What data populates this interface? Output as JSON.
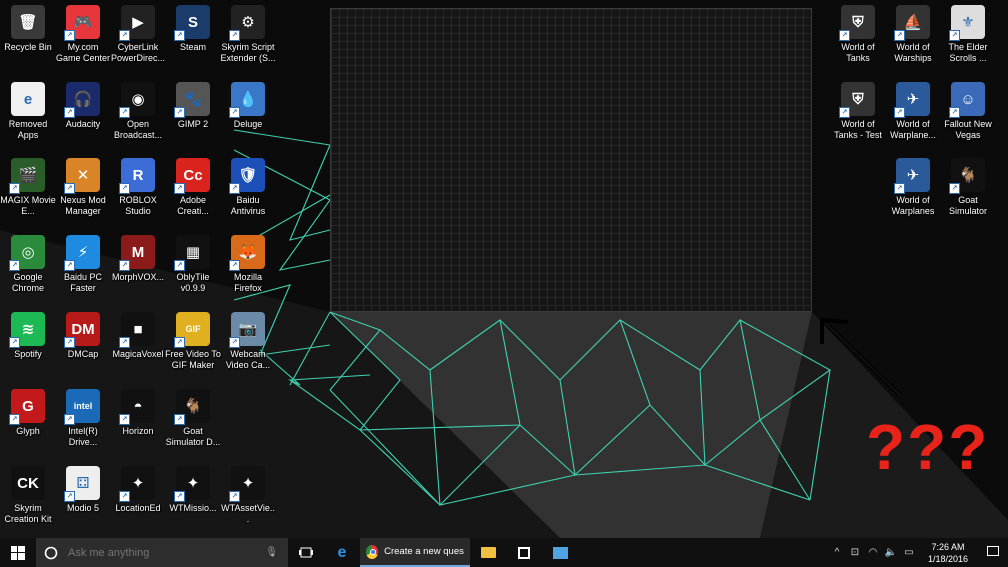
{
  "desktop": {
    "icons": [
      {
        "label": "Recycle Bin",
        "icon": "recycle-bin-icon",
        "color": "#3a3a3a",
        "glyph": "🗑",
        "shortcut": false
      },
      {
        "label": "My.com Game Center",
        "icon": "gamepad-icon",
        "color": "#e8373c",
        "glyph": "🎮",
        "shortcut": true
      },
      {
        "label": "CyberLink PowerDirec...",
        "icon": "video-editor-icon",
        "color": "#222",
        "glyph": "▶",
        "shortcut": true
      },
      {
        "label": "Steam",
        "icon": "steam-icon",
        "color": "#1b3b6b",
        "glyph": "S",
        "shortcut": true
      },
      {
        "label": "Skyrim Script Extender (S...",
        "icon": "gear-icon",
        "color": "#222",
        "glyph": "⚙",
        "shortcut": true
      },
      {
        "label": "Removed Apps",
        "icon": "document-ie-icon",
        "color": "#f0f0f0",
        "glyph": "e",
        "shortcut": false
      },
      {
        "label": "Audacity",
        "icon": "headphones-icon",
        "color": "#1a2a6a",
        "glyph": "🎧",
        "shortcut": true
      },
      {
        "label": "Open Broadcast...",
        "icon": "obs-icon",
        "color": "#111",
        "glyph": "◉",
        "shortcut": true
      },
      {
        "label": "GIMP 2",
        "icon": "gimp-icon",
        "color": "#555",
        "glyph": "🐾",
        "shortcut": true
      },
      {
        "label": "Deluge",
        "icon": "water-drop-icon",
        "color": "#3b77c8",
        "glyph": "💧",
        "shortcut": true
      },
      {
        "label": "MAGIX Movie E...",
        "icon": "film-icon",
        "color": "#2b5d2b",
        "glyph": "🎬",
        "shortcut": true
      },
      {
        "label": "Nexus Mod Manager",
        "icon": "nexus-icon",
        "color": "#d98426",
        "glyph": "✕",
        "shortcut": true
      },
      {
        "label": "ROBLOX Studio",
        "icon": "roblox-icon",
        "color": "#3c6dd6",
        "glyph": "R",
        "shortcut": true
      },
      {
        "label": "Adobe Creati...",
        "icon": "adobe-cc-icon",
        "color": "#d9231c",
        "glyph": "Cc",
        "shortcut": true
      },
      {
        "label": "Baidu Antivirus",
        "icon": "shield-icon",
        "color": "#1c4fb8",
        "glyph": "🛡",
        "shortcut": true
      },
      {
        "label": "Google Chrome",
        "icon": "chrome-icon",
        "color": "#2a8b3c",
        "glyph": "◎",
        "shortcut": true
      },
      {
        "label": "Baidu PC Faster",
        "icon": "speed-icon",
        "color": "#1f8be0",
        "glyph": "⚡",
        "shortcut": true
      },
      {
        "label": "MorphVOX...",
        "icon": "morphvox-icon",
        "color": "#8b1a1a",
        "glyph": "M",
        "shortcut": true
      },
      {
        "label": "OblyTile v0.9.9",
        "icon": "tiles-icon",
        "color": "#111",
        "glyph": "▦",
        "shortcut": true
      },
      {
        "label": "Mozilla Firefox",
        "icon": "firefox-icon",
        "color": "#d86a1a",
        "glyph": "🦊",
        "shortcut": true
      },
      {
        "label": "Spotify",
        "icon": "spotify-icon",
        "color": "#1db954",
        "glyph": "≋",
        "shortcut": true
      },
      {
        "label": "DMCap",
        "icon": "dmcap-icon",
        "color": "#b81a1a",
        "glyph": "DM",
        "shortcut": true
      },
      {
        "label": "MagicaVoxel",
        "icon": "voxel-icon",
        "color": "#111",
        "glyph": "■",
        "shortcut": true
      },
      {
        "label": "Free Video To GIF Maker",
        "icon": "gif-icon",
        "color": "#e0b020",
        "glyph": "GIF",
        "shortcut": true
      },
      {
        "label": "Webcam Video Ca...",
        "icon": "webcam-icon",
        "color": "#6a8aa8",
        "glyph": "📷",
        "shortcut": true
      },
      {
        "label": "Glyph",
        "icon": "glyph-icon",
        "color": "#c21a1a",
        "glyph": "G",
        "shortcut": true
      },
      {
        "label": "Intel(R) Drive...",
        "icon": "intel-icon",
        "color": "#1a6ab8",
        "glyph": "intel",
        "shortcut": true
      },
      {
        "label": "Horizon",
        "icon": "horizon-icon",
        "color": "#111",
        "glyph": "◓",
        "shortcut": true
      },
      {
        "label": "Goat Simulator D...",
        "icon": "goat-icon",
        "color": "#111",
        "glyph": "🐐",
        "shortcut": true
      },
      {
        "label": "Skyrim Creation Kit",
        "icon": "creation-kit-icon",
        "color": "#111",
        "glyph": "CK",
        "shortcut": false
      },
      {
        "label": "Modio 5",
        "icon": "dice-icon",
        "color": "#eee",
        "glyph": "⚃",
        "shortcut": true
      },
      {
        "label": "LocationEd",
        "icon": "warthunder-icon",
        "color": "#111",
        "glyph": "✦",
        "shortcut": true
      },
      {
        "label": "WTMissio...",
        "icon": "warthunder-icon",
        "color": "#111",
        "glyph": "✦",
        "shortcut": true
      },
      {
        "label": "WTAssetVie...",
        "icon": "warthunder-icon",
        "color": "#111",
        "glyph": "✦",
        "shortcut": true
      },
      {
        "label": "World of Tanks",
        "icon": "tank-helmet-icon",
        "color": "#333",
        "glyph": "⛨",
        "shortcut": true
      },
      {
        "label": "World of Warships",
        "icon": "ship-icon",
        "color": "#333",
        "glyph": "⛵",
        "shortcut": true
      },
      {
        "label": "The Elder Scrolls ...",
        "icon": "skyrim-dragon-icon",
        "color": "#ddd",
        "glyph": "⚜",
        "shortcut": true
      },
      {
        "label": "World of Tanks - Test",
        "icon": "tank-helmet-icon",
        "color": "#333",
        "glyph": "⛨",
        "shortcut": true
      },
      {
        "label": "World of Warplane...",
        "icon": "plane-icon",
        "color": "#2a5a9a",
        "glyph": "✈",
        "shortcut": true
      },
      {
        "label": "Fallout New Vegas",
        "icon": "vault-boy-icon",
        "color": "#3a6ab8",
        "glyph": "☺",
        "shortcut": true
      },
      {
        "label": "World of Warplanes",
        "icon": "plane-icon",
        "color": "#2a5a9a",
        "glyph": "✈",
        "shortcut": true
      },
      {
        "label": "Goat Simulator",
        "icon": "goat-icon",
        "color": "#111",
        "glyph": "🐐",
        "shortcut": true
      }
    ],
    "annotation_text": "???"
  },
  "taskbar": {
    "search_placeholder": "Ask me anything",
    "active_app_title": "Create a new questi...",
    "clock_time": "7:26 AM",
    "clock_date": "1/18/2016"
  },
  "colors": {
    "line_accent": "#3fd1b2",
    "annotation_red": "#e8231a"
  }
}
